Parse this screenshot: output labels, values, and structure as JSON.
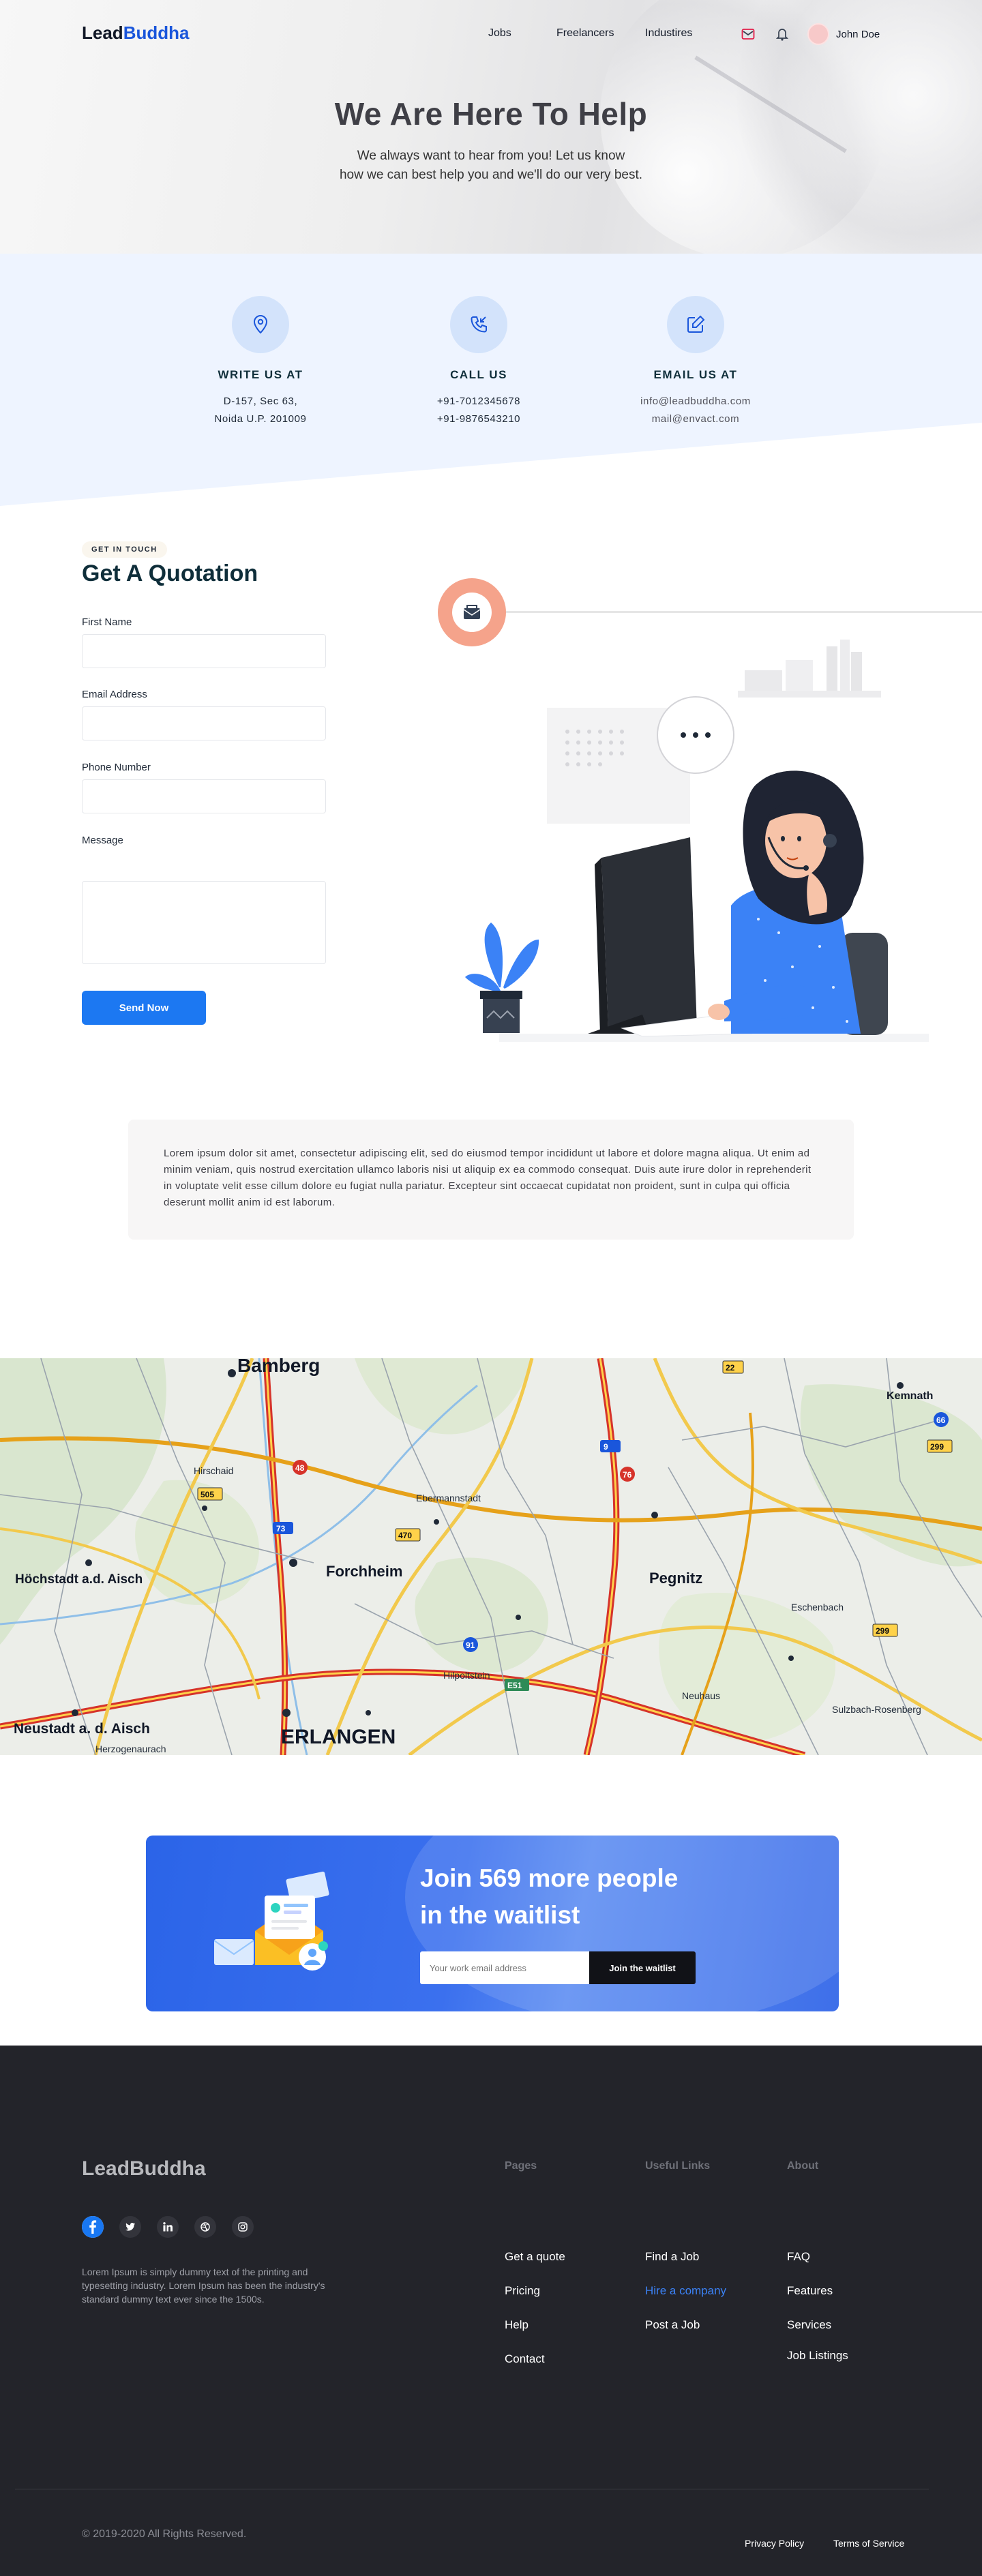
{
  "brand": {
    "name_part1": "Lead",
    "name_part2": "Buddha",
    "accent_color": "#1a56db"
  },
  "nav": {
    "links": [
      "Jobs",
      "Freelancers",
      "Industires"
    ],
    "user_name": "John Doe",
    "icons": [
      "mail-icon",
      "bell-icon"
    ]
  },
  "hero": {
    "title": "We Are Here To Help",
    "subtitle_line1": "We always want to hear from you! Let us know",
    "subtitle_line2": "how we can best help you and we'll do our very best."
  },
  "contact": [
    {
      "icon": "location-pin-icon",
      "title": "WRITE US AT",
      "line1": "D-157, Sec 63,",
      "line2": "Noida U.P. 201009"
    },
    {
      "icon": "phone-incoming-icon",
      "title": "CALL US",
      "line1": "+91-7012345678",
      "line2": "+91-9876543210"
    },
    {
      "icon": "edit-box-icon",
      "title": "EMAIL US AT",
      "line1": "info@leadbuddha.com",
      "line2": "mail@envact.com"
    }
  ],
  "quotation": {
    "tag": "GET IN TOUCH",
    "title": "Get A Quotation",
    "labels": {
      "first_name": "First Name",
      "email": "Email Address",
      "phone": "Phone Number",
      "message": "Message"
    },
    "send_label": "Send Now"
  },
  "lorem": "Lorem ipsum dolor sit amet, consectetur adipiscing elit, sed do eiusmod tempor incididunt ut labore et dolore magna aliqua. Ut enim ad minim veniam, quis nostrud exercitation ullamco laboris nisi ut aliquip ex ea commodo consequat. Duis aute irure dolor in reprehenderit in voluptate velit esse cillum dolore eu fugiat nulla pariatur. Excepteur sint occaecat cupidatat non proident, sunt in culpa qui officia deserunt mollit anim id est laborum.",
  "map": {
    "places": [
      "Bamberg",
      "Forchheim",
      "ERLANGEN",
      "Höchstadt a.d. Aisch",
      "Neustadt a. d. Aisch",
      "Pegnitz",
      "Kemnath",
      "Hirschaid",
      "Ebermannstadt",
      "Herzogenaurach",
      "Eschenbach",
      "Sulzbach-Rosenberg",
      "Hilpoltstein",
      "Neuhaus"
    ]
  },
  "waitlist": {
    "title_line1": "Join 569 more people",
    "title_line2": "in the waitlist",
    "email_placeholder": "Your work email address",
    "button_label": "Join the waitlist"
  },
  "footer": {
    "logo": "LeadBuddha",
    "description": "Lorem Ipsum is simply dummy text of the printing and typesetting industry. Lorem Ipsum has been the industry's standard dummy text ever since the 1500s.",
    "socials": [
      "facebook-icon",
      "twitter-icon",
      "linkedin-icon",
      "dribbble-icon",
      "instagram-icon"
    ],
    "columns": [
      {
        "title": "Pages",
        "links": [
          "Get a quote",
          "Pricing",
          "Help",
          "Contact"
        ]
      },
      {
        "title": "Useful Links",
        "links": [
          "Find a Job",
          "Hire a company",
          "Post a Job"
        ],
        "active_index": 1
      },
      {
        "title": "About",
        "links": [
          "FAQ",
          "Features",
          "Services",
          "Job Listings"
        ]
      }
    ],
    "copyright": "© 2019-2020 All Rights Reserved.",
    "legal": [
      "Privacy Policy",
      "Terms of Service"
    ],
    "link_active_color": "#3b82f6"
  }
}
